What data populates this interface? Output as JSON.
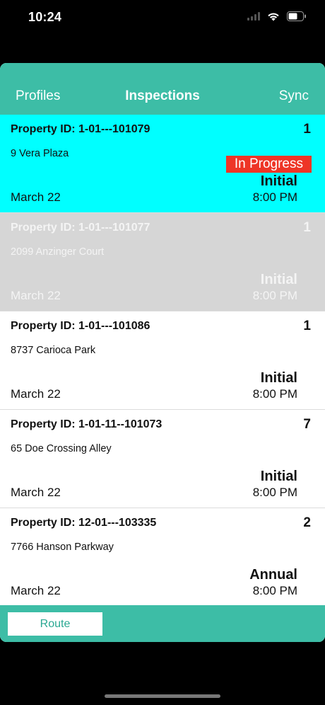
{
  "status_bar": {
    "time": "10:24",
    "icons": [
      "cellular-icon",
      "wifi-icon",
      "battery-icon"
    ]
  },
  "navbar": {
    "left": "Profiles",
    "title": "Inspections",
    "right": "Sync",
    "color": "#3dbda6"
  },
  "inspections": [
    {
      "property_id": "Property ID: 1-01---101079",
      "count": "1",
      "address": "9 Vera Plaza",
      "status": "In Progress",
      "type": "Initial",
      "date": "March 22",
      "time": "8:00 PM",
      "state": "active"
    },
    {
      "property_id": "Property ID: 1-01---101077",
      "count": "1",
      "address": "2099 Anzinger Court",
      "type": "Initial",
      "date": "March 22",
      "time": "8:00 PM",
      "state": "disabled"
    },
    {
      "property_id": "Property ID: 1-01---101086",
      "count": "1",
      "address": "8737 Carioca Park",
      "type": "Initial",
      "date": "March 22",
      "time": "8:00 PM",
      "state": "normal"
    },
    {
      "property_id": "Property ID: 1-01-11--101073",
      "count": "7",
      "address": "65 Doe Crossing Alley",
      "type": "Initial",
      "date": "March 22",
      "time": "8:00 PM",
      "state": "normal"
    },
    {
      "property_id": "Property ID: 12-01---103335",
      "count": "2",
      "address": "7766 Hanson Parkway",
      "type": "Annual",
      "date": "March 22",
      "time": "8:00 PM",
      "state": "normal"
    }
  ],
  "colors": {
    "active_row": "#00ffff",
    "disabled_row": "#d6d6d6",
    "status_tag": "#ee3526"
  },
  "toolbar": {
    "route_label": "Route"
  }
}
